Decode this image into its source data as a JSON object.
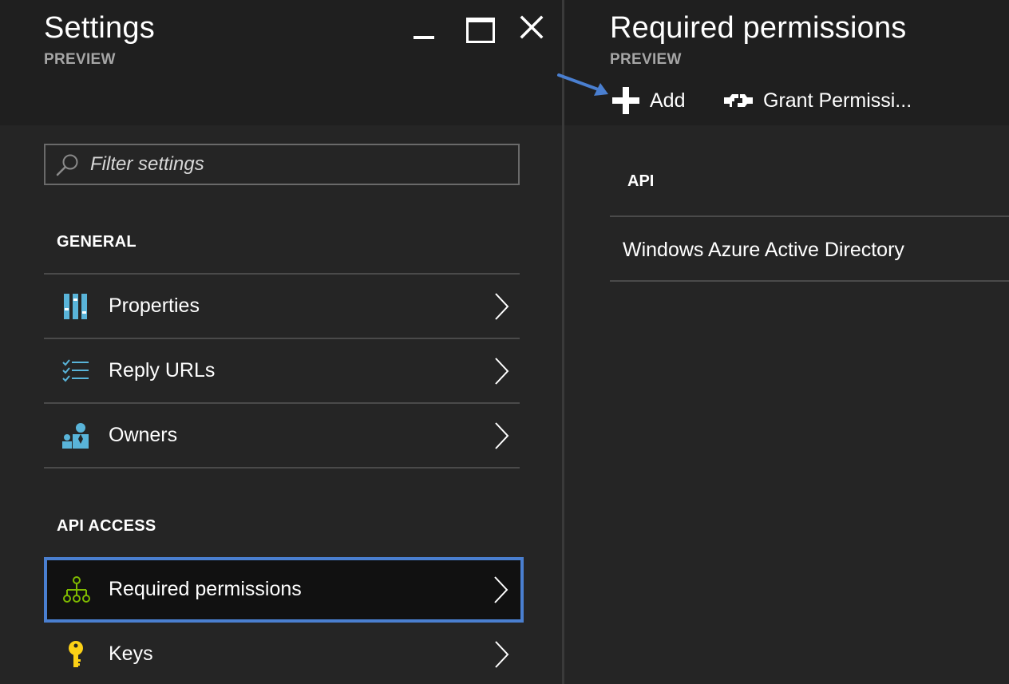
{
  "settings_blade": {
    "title": "Settings",
    "subtitle": "PREVIEW",
    "filter": {
      "placeholder": "Filter settings",
      "value": ""
    },
    "sections": [
      {
        "label": "GENERAL",
        "items": [
          {
            "label": "Properties",
            "icon": "properties-icon"
          },
          {
            "label": "Reply URLs",
            "icon": "checklist-icon"
          },
          {
            "label": "Owners",
            "icon": "owners-icon"
          }
        ]
      },
      {
        "label": "API ACCESS",
        "items": [
          {
            "label": "Required permissions",
            "icon": "hierarchy-icon",
            "selected": true
          },
          {
            "label": "Keys",
            "icon": "key-icon"
          }
        ]
      }
    ]
  },
  "permissions_blade": {
    "title": "Required permissions",
    "subtitle": "PREVIEW",
    "commands": [
      {
        "label": "Add",
        "icon": "plus-icon"
      },
      {
        "label": "Grant Permissi...",
        "icon": "grant-icon"
      }
    ],
    "grid": {
      "column_header": "API",
      "rows": [
        "Windows Azure Active Directory"
      ]
    }
  },
  "colors": {
    "background": "#252525",
    "header": "#1f1f1f",
    "selection_border": "#4a7fd0",
    "annotation_arrow": "#4a7fd0",
    "icon_blue": "#59b4d9",
    "icon_green": "#7fba00",
    "icon_yellow": "#fcd116"
  }
}
